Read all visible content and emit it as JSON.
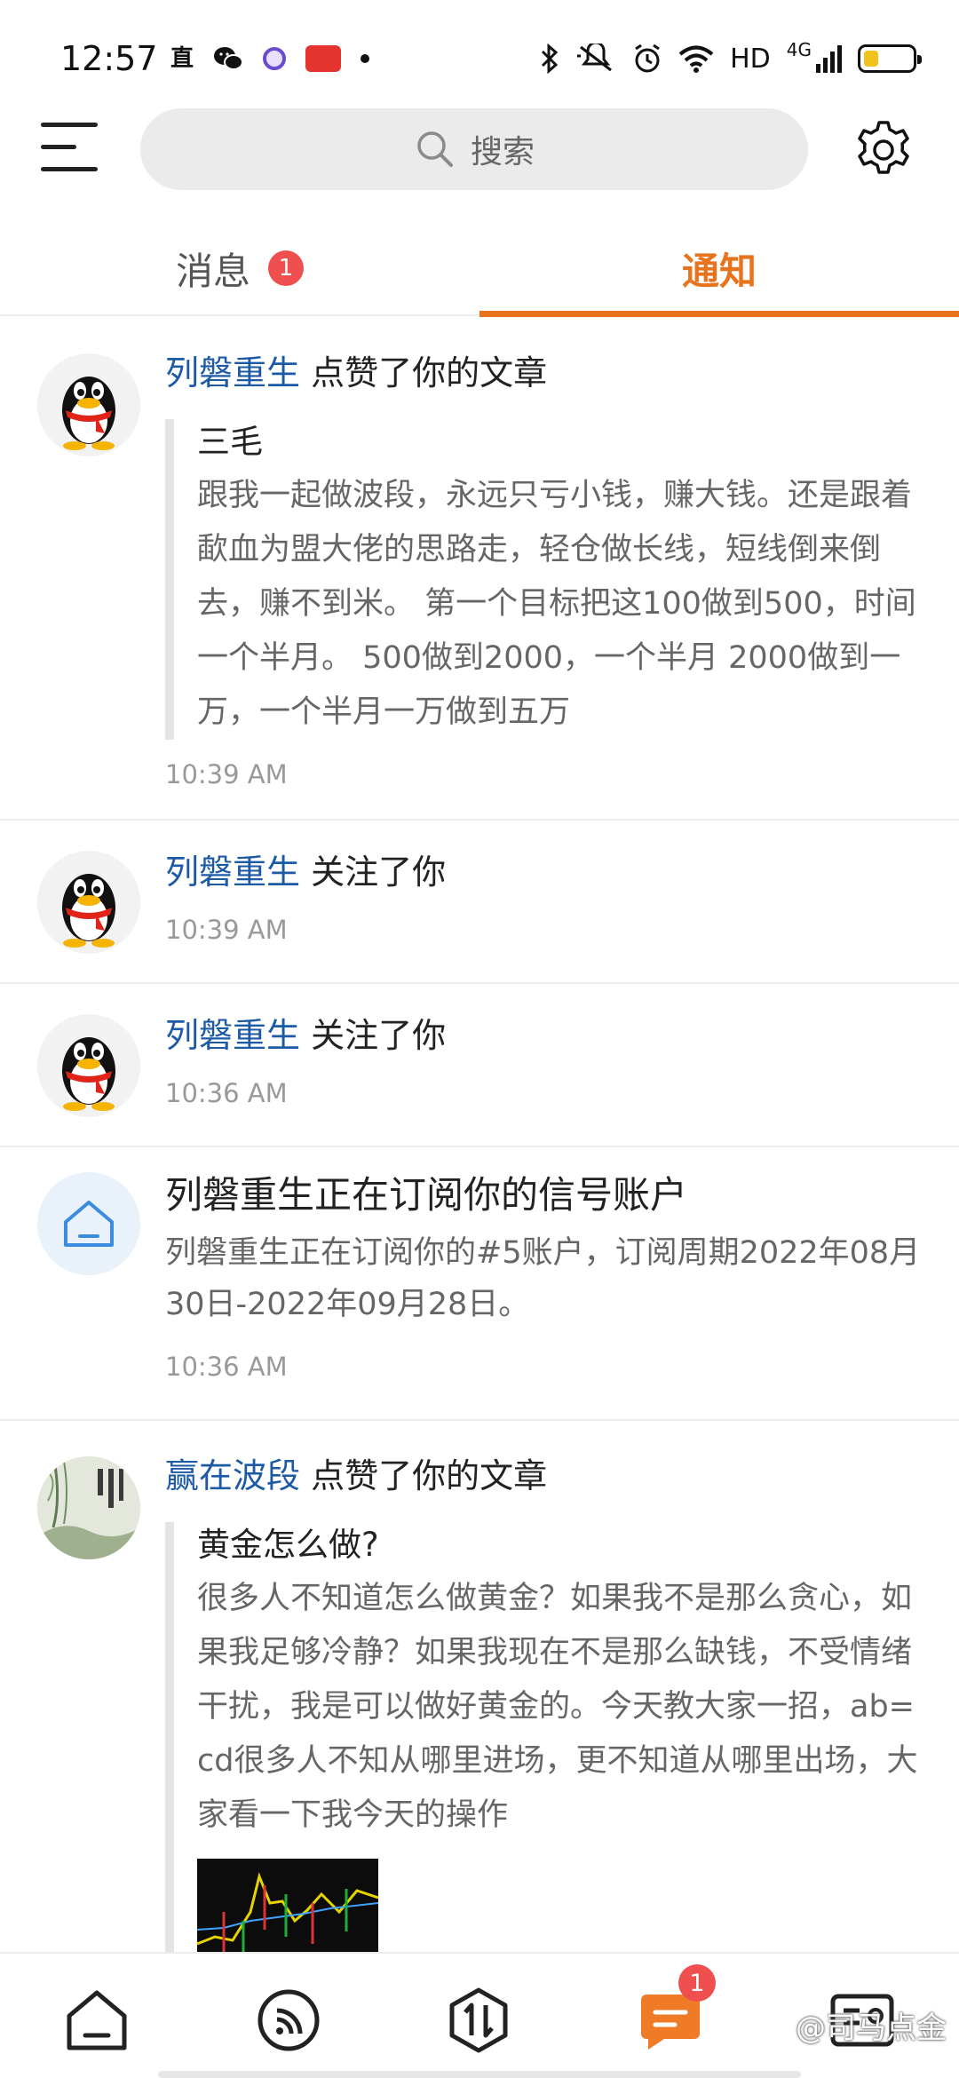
{
  "status_bar": {
    "time": "12:57",
    "left_glyph": "直",
    "network_label": "HD",
    "signal_label": "4G",
    "battery_level_pct": 30
  },
  "header": {
    "search_placeholder": "搜索"
  },
  "tabs": {
    "messages_label": "消息",
    "messages_badge": "1",
    "notifications_label": "通知"
  },
  "notifications": [
    {
      "user": "列磐重生",
      "action": " 点赞了你的文章",
      "article_title": "三毛",
      "article_excerpt": "跟我一起做波段，永远只亏小钱，赚大钱。还是跟着歃血为盟大佬的思路走，轻仓做长线，短线倒来倒去，赚不到米。 第一个目标把这100做到500，时间一个半月。 500做到2000，一个半月 2000做到一万，一个半月一万做到五万",
      "time": "10:39 AM"
    },
    {
      "user": "列磐重生",
      "action": " 关注了你",
      "time": "10:39 AM"
    },
    {
      "user": "列磐重生",
      "action": " 关注了你",
      "time": "10:36 AM"
    },
    {
      "title": "列磐重生正在订阅你的信号账户",
      "body": "列磐重生正在订阅你的#5账户，订阅周期2022年08月30日-2022年09月28日。",
      "time": "10:36 AM"
    },
    {
      "user": "赢在波段",
      "action": " 点赞了你的文章",
      "article_title": "黄金怎么做?",
      "article_excerpt": "很多人不知道怎么做黄金？如果我不是那么贪心，如果我足够冷静？如果我现在不是那么缺钱，不受情绪干扰，我是可以做好黄金的。今天教大家一招，ab=cd很多人不知从哪里进场，更不知道从哪里出场，大家看一下我今天的操作"
    }
  ],
  "bottom_nav": {
    "messages_badge": "1",
    "watermark": "@司马点金"
  },
  "colors": {
    "accent": "#e8731d",
    "link_blue": "#1c5aa6",
    "badge_red": "#ef4f4f"
  },
  "icons": [
    "menu-icon",
    "search-icon",
    "gear-icon",
    "qq-penguin-avatar",
    "house-icon",
    "home-icon",
    "feed-icon",
    "trade-icon",
    "chat-icon",
    "profile-card-icon"
  ]
}
